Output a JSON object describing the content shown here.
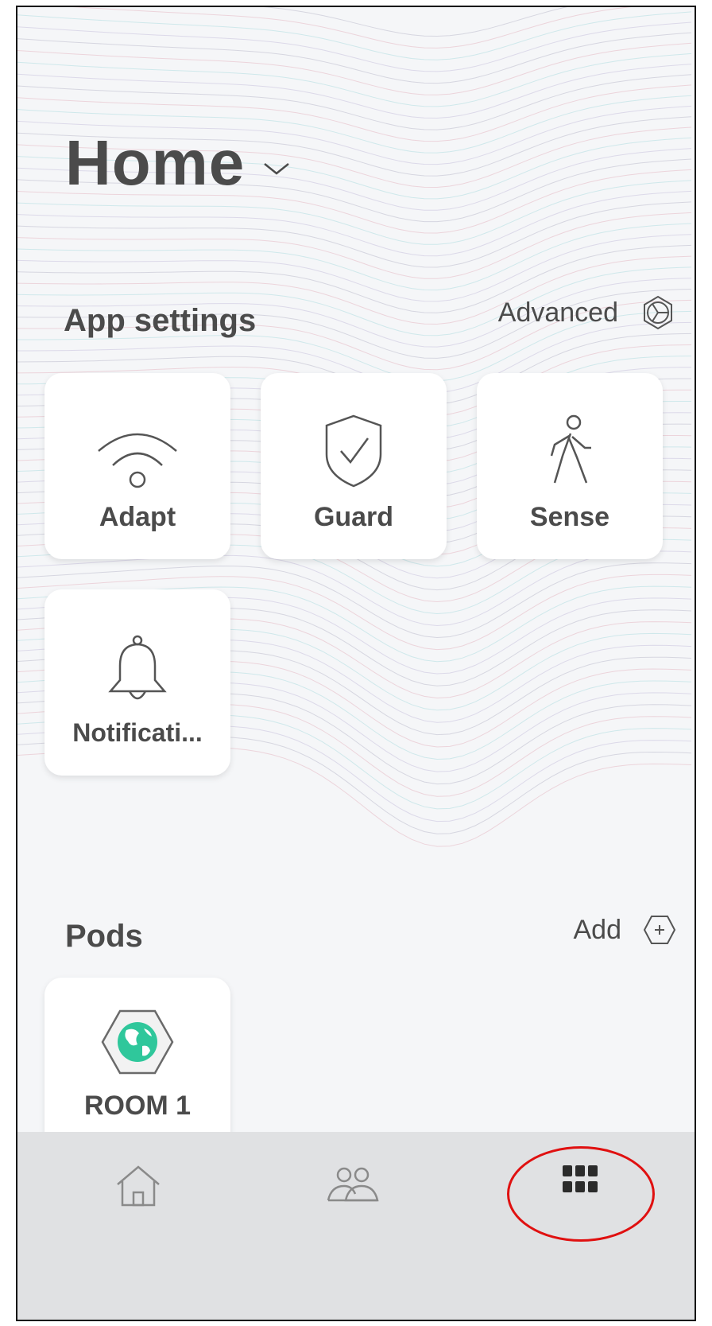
{
  "header": {
    "title": "Home"
  },
  "app_settings": {
    "title": "App settings",
    "advanced_label": "Advanced",
    "tiles": [
      {
        "label": "Adapt",
        "icon": "wifi-icon"
      },
      {
        "label": "Guard",
        "icon": "shield-check-icon"
      },
      {
        "label": "Sense",
        "icon": "walking-person-icon"
      },
      {
        "label": "Notificati...",
        "icon": "bell-icon"
      }
    ]
  },
  "pods": {
    "title": "Pods",
    "add_label": "Add",
    "items": [
      {
        "label": "ROOM 1",
        "icon": "globe-hexagon-icon"
      }
    ]
  },
  "bottom_nav": {
    "items": [
      {
        "icon": "home-icon"
      },
      {
        "icon": "people-icon"
      },
      {
        "icon": "grid-menu-icon",
        "highlighted": true
      }
    ]
  },
  "colors": {
    "background": "#f5f6f8",
    "text": "#4b4b4b",
    "pod_accent": "#2fc79b",
    "nav_background": "#e0e1e3",
    "highlight": "#e01010"
  }
}
